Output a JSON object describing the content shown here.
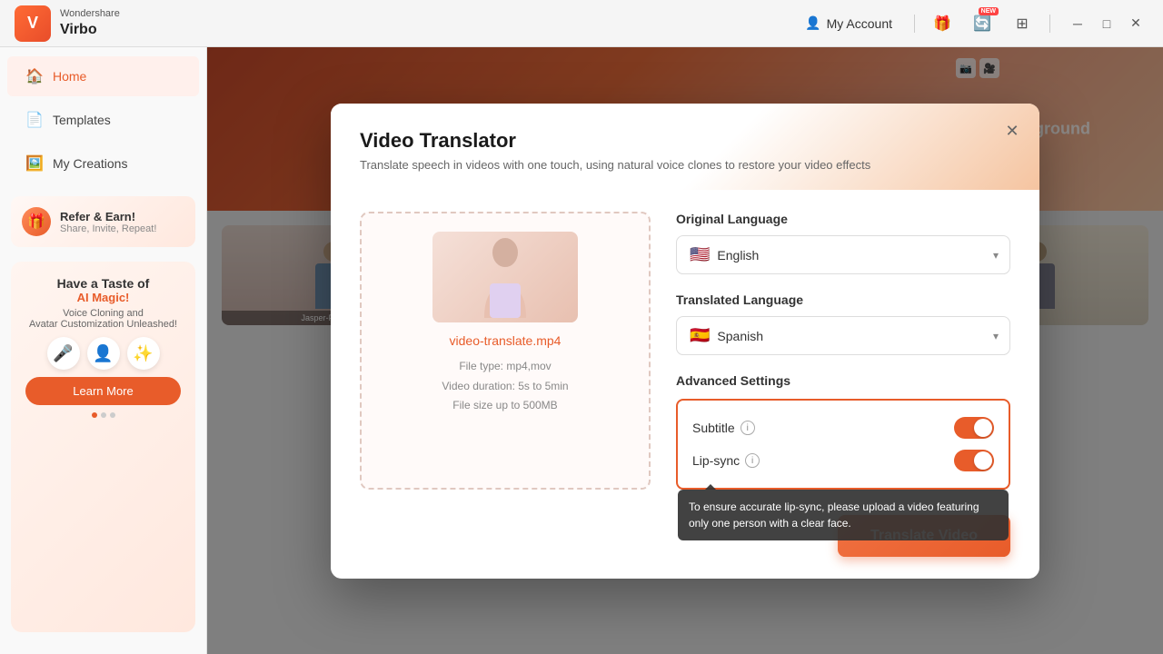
{
  "app": {
    "wonder_label": "Wondershare",
    "virbo_label": "Virbo"
  },
  "titlebar": {
    "my_account": "My Account",
    "new_badge": "NEW",
    "icons": [
      "gift-icon",
      "history-icon",
      "grid-icon",
      "minimize-icon",
      "maximize-icon",
      "close-icon"
    ]
  },
  "sidebar": {
    "home_label": "Home",
    "templates_label": "Templates",
    "my_creations_label": "My Creations"
  },
  "refer": {
    "title": "Refer & Earn!",
    "subtitle": "Share, Invite, Repeat!"
  },
  "promo": {
    "title": "Have a Taste of",
    "title2": "AI Magic!",
    "desc": "Voice Cloning and\nAvatar Customization Unleashed!",
    "learn_more": "Learn More"
  },
  "bg_content": {
    "transparent_bg": "Transparent Background"
  },
  "avatars": [
    {
      "label": "Jasper-Promotion"
    },
    {
      "label": ""
    },
    {
      "label": ""
    },
    {
      "label": ""
    }
  ],
  "modal": {
    "title": "Video Translator",
    "subtitle": "Translate speech in videos with one touch, using natural voice clones to restore your video effects",
    "upload": {
      "filename": "video-translate.mp4",
      "file_type": "File type: mp4,mov",
      "duration": "Video duration: 5s to 5min",
      "size": "File size up to  500MB"
    },
    "original_language_label": "Original Language",
    "original_language_value": "English",
    "original_language_flag": "🇺🇸",
    "translated_language_label": "Translated Language",
    "translated_language_value": "Spanish",
    "translated_language_flag": "🇪🇸",
    "advanced_label": "Advanced Settings",
    "subtitle_toggle_label": "Subtitle",
    "lipsync_toggle_label": "Lip-sync",
    "tooltip": "To ensure accurate lip-sync, please upload a\nvideo featuring only one person with a clear face.",
    "translate_btn": "Translate Video"
  }
}
